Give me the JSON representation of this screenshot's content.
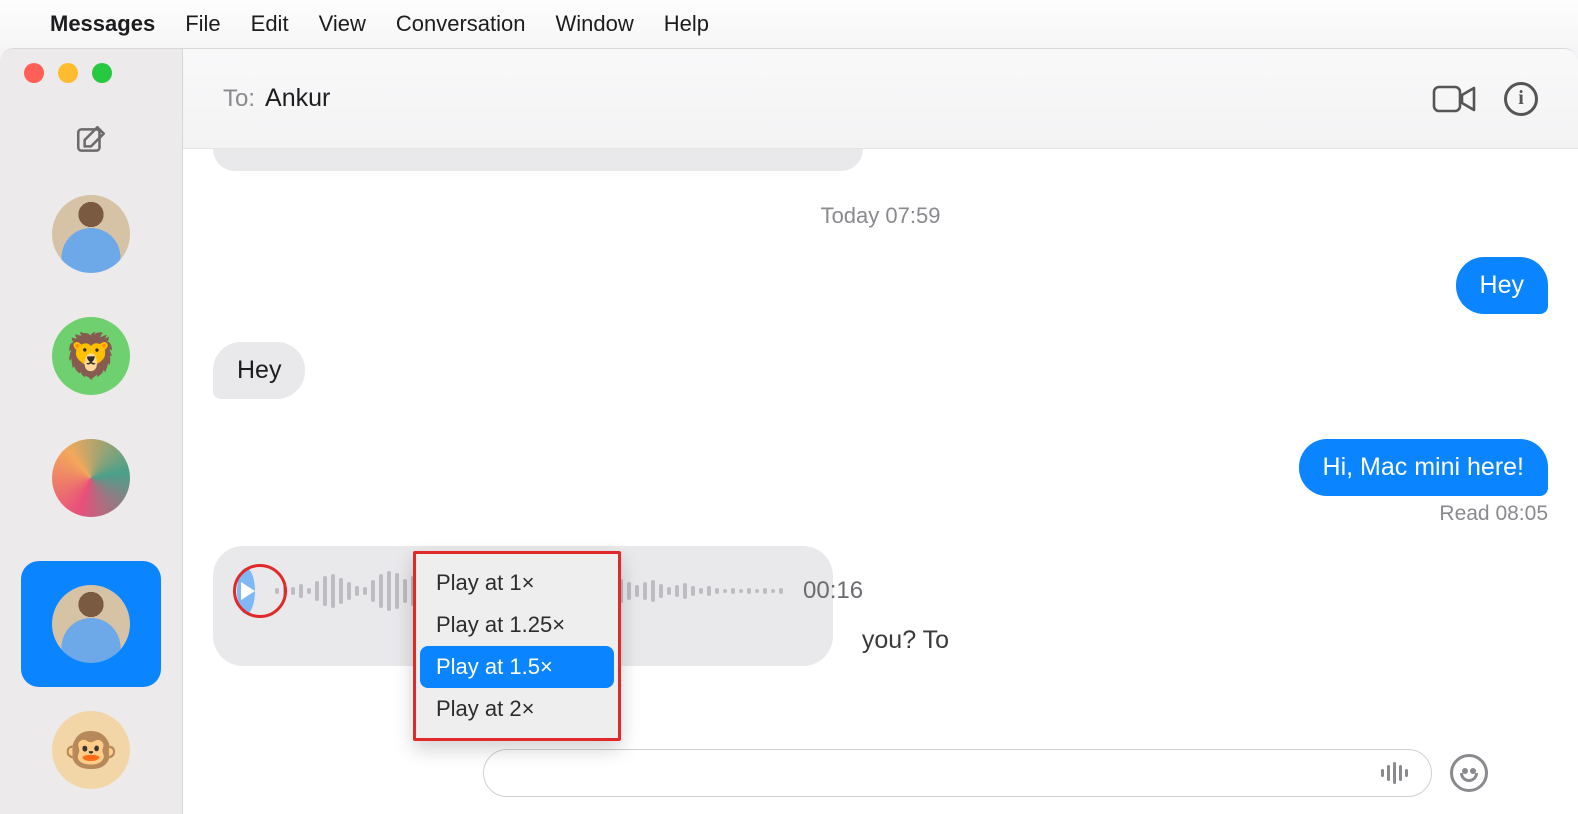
{
  "menubar": {
    "app_name": "Messages",
    "items": [
      "File",
      "Edit",
      "View",
      "Conversation",
      "Window",
      "Help"
    ]
  },
  "header": {
    "to_label": "To:",
    "recipient": "Ankur"
  },
  "conversation": {
    "timestamp": "Today 07:59",
    "messages": [
      {
        "side": "right",
        "text": "Hey"
      },
      {
        "side": "left",
        "text": "Hey"
      },
      {
        "side": "right",
        "text": "Hi, Mac mini here!"
      }
    ],
    "read_receipt": "Read 08:05",
    "audio": {
      "duration": "00:16",
      "transcript_tail": "you? To"
    }
  },
  "context_menu": {
    "items": [
      "Play at 1×",
      "Play at 1.25×",
      "Play at 1.5×",
      "Play at 2×"
    ],
    "selected_index": 2
  },
  "sidebar": {
    "avatars": [
      "person",
      "lion",
      "wave",
      "person",
      "monkey"
    ],
    "selected_index": 3
  }
}
